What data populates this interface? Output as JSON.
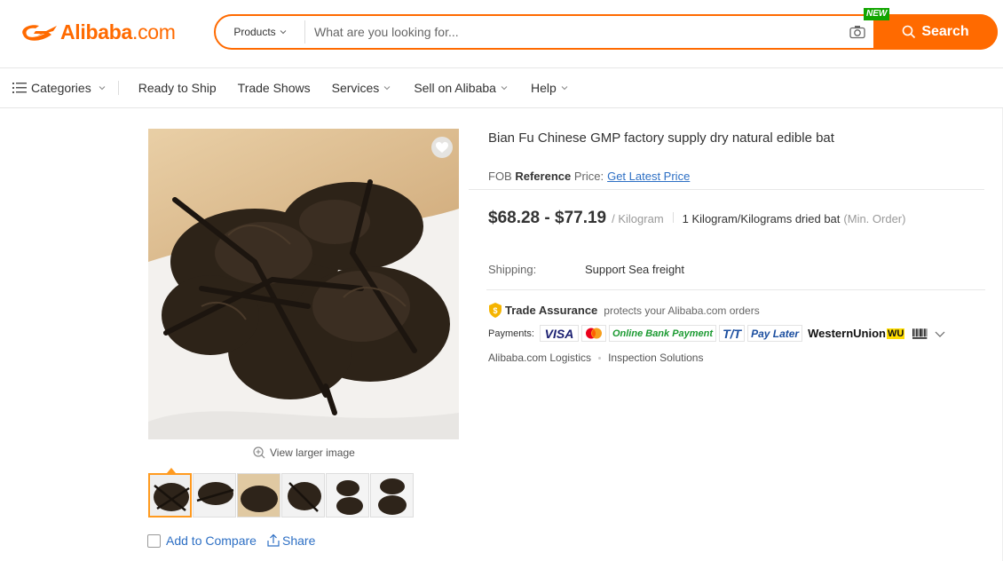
{
  "header": {
    "logo_text": "Alibaba",
    "logo_dotcom": ".com",
    "search_category": "Products",
    "search_placeholder": "What are you looking for...",
    "new_badge": "NEW",
    "search_button": "Search"
  },
  "nav": {
    "categories": "Categories",
    "items": [
      "Ready to Ship",
      "Trade Shows",
      "Services",
      "Sell on Alibaba",
      "Help"
    ]
  },
  "gallery": {
    "view_larger": "View larger image",
    "thumbnail_count": 6,
    "add_to_compare": "Add to Compare",
    "share": "Share"
  },
  "product": {
    "title": "Bian Fu Chinese GMP factory supply dry natural edible bat",
    "fob_prefix": "FOB",
    "fob_reference": "Reference",
    "fob_suffix": "Price:",
    "get_latest_price": "Get Latest Price",
    "price_range": "$68.28 - $77.19",
    "price_unit": "/ Kilogram",
    "moq": "1 Kilogram/Kilograms dried bat",
    "moq_note": "(Min. Order)",
    "shipping_label": "Shipping:",
    "shipping_value": "Support Sea freight",
    "trade_assurance": "Trade Assurance",
    "trade_assurance_note": "protects your Alibaba.com orders",
    "payments_label": "Payments:",
    "payment_methods": [
      "VISA",
      "Online Bank Payment",
      "T/T",
      "Pay Later",
      "WesternUnion",
      "WU"
    ],
    "logistics": "Alibaba.com Logistics",
    "inspection": "Inspection Solutions"
  },
  "colors": {
    "brand": "#ff6a00",
    "link": "#2d6fc4",
    "new_badge": "#12a500"
  }
}
